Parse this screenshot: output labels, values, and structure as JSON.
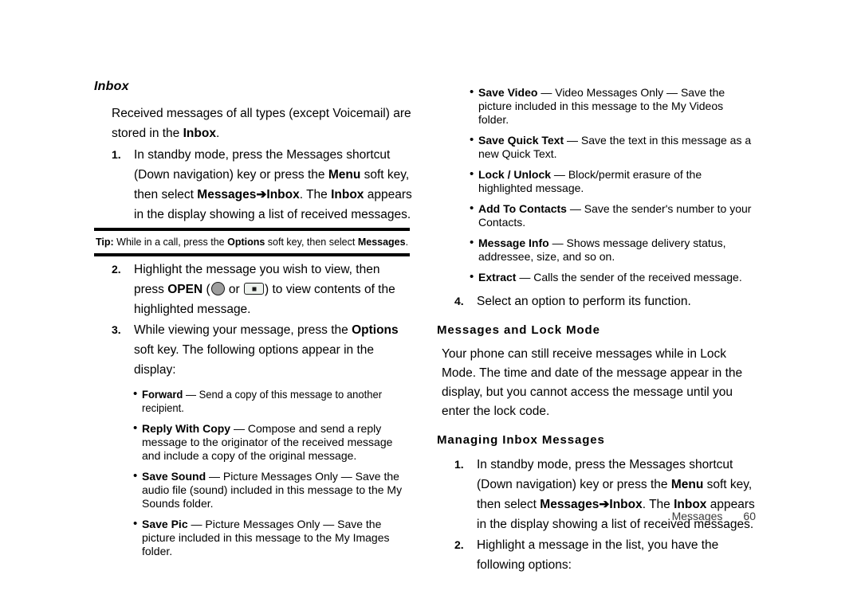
{
  "document": {
    "title": "Inbox",
    "footer": {
      "section": "Messages",
      "page_number": "60"
    }
  },
  "left_column": {
    "heading": "Inbox",
    "intro": {
      "before_bold": "Received messages of all types (except Voicemail) are stored in the ",
      "bold": "Inbox",
      "after_bold": "."
    },
    "step1": {
      "number": "1.",
      "part1": "In standby mode, press the Messages shortcut (Down navigation) key or press the ",
      "bold1": "Menu",
      "part2": " soft key, then select ",
      "bold2": "Messages",
      "arrow": "➔",
      "bold3": "Inbox",
      "part3": ". The ",
      "bold4": "Inbox",
      "part4": " appears in the display showing a list of received messages."
    },
    "tip": {
      "label": "Tip:",
      "part1": " While in a call, press the ",
      "bold1": "Options",
      "part2": " soft key, then select ",
      "bold2": "Messages",
      "part3": "."
    },
    "step2": {
      "number": "2.",
      "part1": "Highlight the message you wish to view, then press ",
      "bold1": "OPEN",
      "part2": " (",
      "key_ok": "ok-key-icon",
      "part3": " or ",
      "key_asterisk": "asterisk-key-icon",
      "part4": ") to view contents of the highlighted message."
    },
    "step3": {
      "number": "3.",
      "part1": "While viewing your message, press the ",
      "bold1": "Options",
      "part2": " soft key. The following options appear in the display:"
    },
    "options": [
      {
        "term": "Forward",
        "dash": " — ",
        "desc": "Send a copy of this message to another recipient."
      },
      {
        "term": "Reply With Copy",
        "dash": " — ",
        "desc": "Compose and send a reply message to the originator of the received message and include a copy of the original message."
      },
      {
        "term": "Save Sound",
        "dash": " — ",
        "desc": "Picture Messages Only — Save the audio file (sound) included in this message to the My Sounds folder."
      },
      {
        "term": "Save Pic",
        "dash": " — ",
        "desc": "Picture Messages Only — Save the picture included in this message to the My Images folder."
      }
    ]
  },
  "right_column": {
    "options": [
      {
        "term": "Save Video",
        "dash": " — ",
        "desc": "Video Messages Only — Save the picture included in this message to the My Videos folder."
      },
      {
        "term": "Save Quick Text",
        "dash": " — ",
        "desc": "Save the text in this message as a new Quick Text."
      },
      {
        "term": "Lock / Unlock",
        "dash": " — ",
        "desc": "Block/permit erasure of the highlighted message."
      },
      {
        "term": "Add To Contacts",
        "dash": " — ",
        "desc": "Save the sender's number to your Contacts."
      },
      {
        "term": "Message Info",
        "dash": " — ",
        "desc": "Shows message delivery status, addressee, size, and so on."
      },
      {
        "term": "Extract",
        "dash": " — ",
        "desc": "Calls the sender of the received message."
      }
    ],
    "step4": {
      "number": "4.",
      "text": "Select an option to perform its function."
    },
    "lock_mode": {
      "heading": "Messages and Lock Mode",
      "paragraph": "Your phone can still receive messages while in Lock Mode. The time and date of the message appear in the display, but you cannot access the message until you enter the lock code."
    },
    "managing": {
      "heading": "Managing Inbox Messages",
      "step1": {
        "number": "1.",
        "part1": "In standby mode, press the Messages shortcut (Down navigation) key or press the ",
        "bold1": "Menu",
        "part2": " soft key, then select ",
        "bold2": "Messages",
        "arrow": "➔",
        "bold3": "Inbox",
        "part3": ". The ",
        "bold4": "Inbox",
        "part4": " appears in the display showing a list of received messages."
      },
      "step2": {
        "number": "2.",
        "text": "Highlight a message in the list, you have the following options:"
      }
    }
  }
}
